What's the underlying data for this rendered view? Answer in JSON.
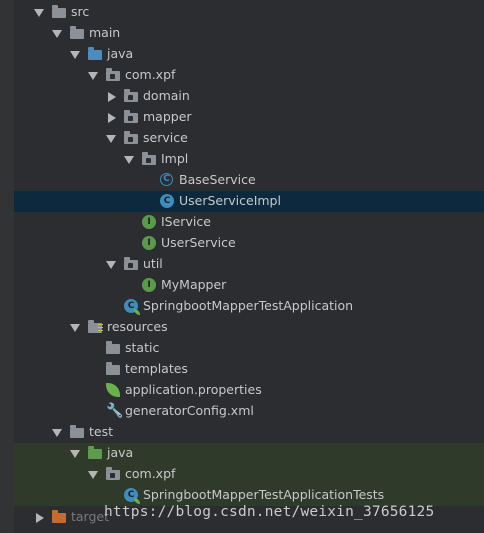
{
  "tree": [
    {
      "label": "src",
      "arrow": "down",
      "icon": "folder-gray",
      "icon_name": "folder-icon"
    },
    {
      "label": "main",
      "arrow": "down",
      "icon": "folder-gray",
      "icon_name": "folder-icon"
    },
    {
      "label": "java",
      "arrow": "down",
      "icon": "folder-blue",
      "icon_name": "source-folder-icon"
    },
    {
      "label": "com.xpf",
      "arrow": "down",
      "icon": "package",
      "icon_name": "package-icon"
    },
    {
      "label": "domain",
      "arrow": "right",
      "icon": "package",
      "icon_name": "package-icon"
    },
    {
      "label": "mapper",
      "arrow": "right",
      "icon": "package",
      "icon_name": "package-icon"
    },
    {
      "label": "service",
      "arrow": "down",
      "icon": "package",
      "icon_name": "package-icon"
    },
    {
      "label": "Impl",
      "arrow": "down",
      "icon": "package",
      "icon_name": "package-icon"
    },
    {
      "label": "BaseService",
      "arrow": "none",
      "icon": "abstract-class",
      "icon_name": "abstract-class-icon"
    },
    {
      "label": "UserServiceImpl",
      "arrow": "none",
      "icon": "class",
      "icon_name": "class-icon",
      "selected": true
    },
    {
      "label": "IService",
      "arrow": "none",
      "icon": "interface",
      "icon_name": "interface-icon"
    },
    {
      "label": "UserService",
      "arrow": "none",
      "icon": "interface",
      "icon_name": "interface-icon"
    },
    {
      "label": "util",
      "arrow": "down",
      "icon": "package",
      "icon_name": "package-icon"
    },
    {
      "label": "MyMapper",
      "arrow": "none",
      "icon": "interface",
      "icon_name": "interface-icon"
    },
    {
      "label": "SpringbootMapperTestApplication",
      "arrow": "none",
      "icon": "spring-class",
      "icon_name": "spring-boot-class-icon"
    },
    {
      "label": "resources",
      "arrow": "down",
      "icon": "resources",
      "icon_name": "resources-folder-icon"
    },
    {
      "label": "static",
      "arrow": "none",
      "icon": "folder-gray",
      "icon_name": "folder-icon"
    },
    {
      "label": "templates",
      "arrow": "none",
      "icon": "folder-gray",
      "icon_name": "folder-icon"
    },
    {
      "label": "application.properties",
      "arrow": "none",
      "icon": "spring-props",
      "icon_name": "spring-properties-icon"
    },
    {
      "label": "generatorConfig.xml",
      "arrow": "none",
      "icon": "xml",
      "icon_name": "xml-file-icon"
    },
    {
      "label": "test",
      "arrow": "down",
      "icon": "folder-gray",
      "icon_name": "folder-icon"
    },
    {
      "label": "java",
      "arrow": "down",
      "icon": "folder-green",
      "icon_name": "test-source-folder-icon",
      "testbg": true
    },
    {
      "label": "com.xpf",
      "arrow": "down",
      "icon": "package",
      "icon_name": "package-icon",
      "testbg": true
    },
    {
      "label": "SpringbootMapperTestApplicationTests",
      "arrow": "none",
      "icon": "spring-class",
      "icon_name": "spring-boot-class-icon",
      "testbg": true
    },
    {
      "label": "target",
      "arrow": "right",
      "icon": "folder-orange",
      "icon_name": "excluded-folder-icon"
    }
  ],
  "watermark": "https://blog.csdn.net/weixin_37656125",
  "colors": {
    "selection": "#0d293e",
    "test_bg": "#2f3a2b",
    "text": "#c8c8c8"
  }
}
